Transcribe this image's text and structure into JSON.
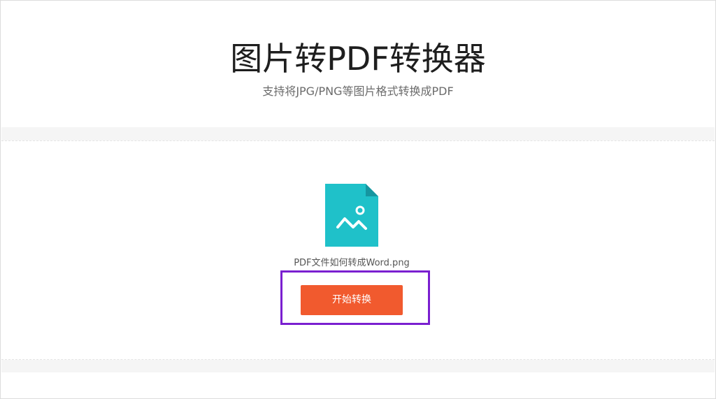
{
  "header": {
    "title": "图片转PDF转换器",
    "subtitle": "支持将JPG/PNG等图片格式转换成PDF"
  },
  "file": {
    "icon": "image-file-icon",
    "name": "PDF文件如何转成Word.png"
  },
  "actions": {
    "convert_label": "开始转换"
  },
  "colors": {
    "icon_teal": "#1fc1c9",
    "icon_fold": "#1596a0",
    "button_orange": "#f15a2e",
    "highlight_purple": "#7a1fd0",
    "title_text": "#1e1e1e",
    "subtitle_text": "#6b6b6b"
  }
}
